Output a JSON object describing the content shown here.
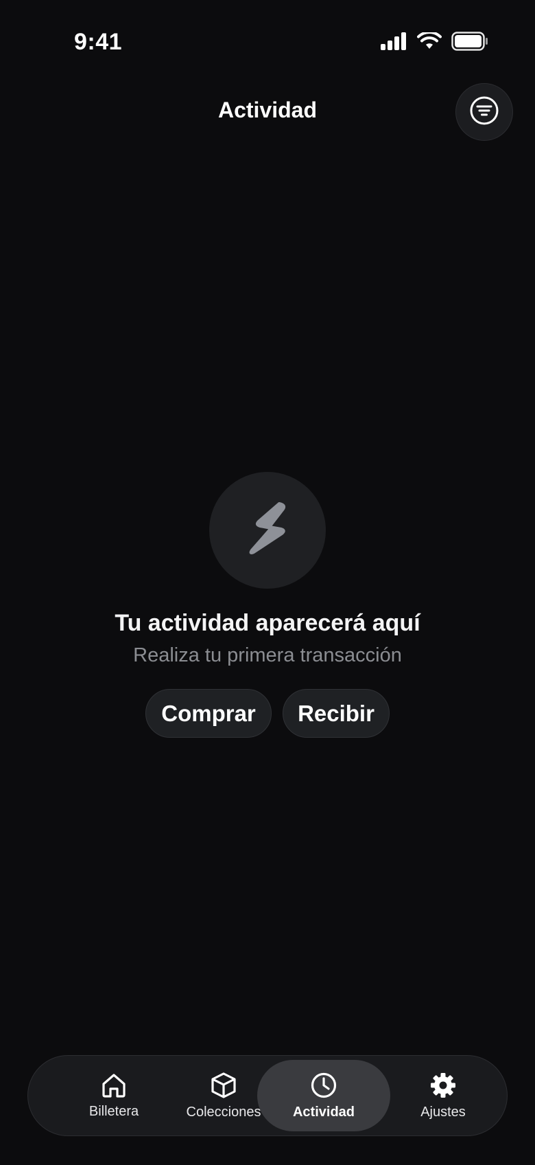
{
  "status_bar": {
    "time": "9:41"
  },
  "header": {
    "title": "Actividad"
  },
  "empty_state": {
    "title": "Tu actividad aparecerá aquí",
    "subtitle": "Realiza tu primera transacción",
    "icon": "lightning-icon"
  },
  "actions": {
    "buy_label": "Comprar",
    "receive_label": "Recibir"
  },
  "bottom_nav": {
    "items": [
      {
        "label": "Billetera",
        "icon": "home-icon",
        "active": false
      },
      {
        "label": "Colecciones",
        "icon": "box-icon",
        "active": false
      },
      {
        "label": "Actividad",
        "icon": "clock-icon",
        "active": true
      },
      {
        "label": "Ajustes",
        "icon": "gear-icon",
        "active": false
      }
    ]
  },
  "colors": {
    "background": "#0c0c0e",
    "surface": "#1f2124",
    "nav_active": "#3a3b3f",
    "muted_text": "#8b8d92",
    "icon_gray": "#8e9198"
  }
}
